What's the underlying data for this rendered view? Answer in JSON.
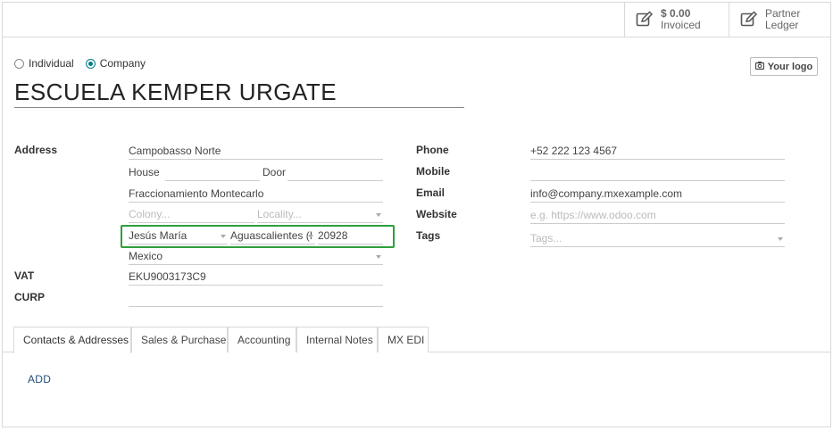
{
  "smart_buttons": {
    "invoiced": {
      "value": "$ 0.00",
      "label": "Invoiced",
      "icon": "pencil-square-icon"
    },
    "partner_ledger": {
      "line1": "Partner",
      "line2": "Ledger",
      "icon": "pencil-square-icon"
    }
  },
  "company_type": {
    "options": [
      {
        "label": "Individual",
        "selected": false
      },
      {
        "label": "Company",
        "selected": true
      }
    ]
  },
  "name": "ESCUELA KEMPER URGATE",
  "logo_button": "Your logo",
  "address": {
    "label": "Address",
    "street": "Campobasso Norte",
    "house_label": "House",
    "door_label": "Door",
    "street2": "Fraccionamiento Montecarlo",
    "colony_placeholder": "Colony...",
    "locality_placeholder": "Locality...",
    "city": "Jesús María",
    "state": "Aguascalientes (MX)",
    "state_display": "Aguascalientes (I",
    "zip": "20928",
    "country": "Mexico"
  },
  "vat": {
    "label": "VAT",
    "value": "EKU9003173C9"
  },
  "curp": {
    "label": "CURP",
    "value": ""
  },
  "phone": {
    "label": "Phone",
    "value": "+52 222 123 4567"
  },
  "mobile": {
    "label": "Mobile",
    "value": ""
  },
  "email": {
    "label": "Email",
    "value": "info@company.mxexample.com"
  },
  "website": {
    "label": "Website",
    "placeholder": "e.g. https://www.odoo.com"
  },
  "tags": {
    "label": "Tags",
    "placeholder": "Tags..."
  },
  "tabs": [
    {
      "label": "Contacts & Addresses",
      "active": true
    },
    {
      "label": "Sales & Purchase",
      "active": false
    },
    {
      "label": "Accounting",
      "active": false
    },
    {
      "label": "Internal Notes",
      "active": false
    },
    {
      "label": "MX EDI",
      "active": false
    }
  ],
  "add_label": "ADD",
  "colors": {
    "accent": "#017e84",
    "highlight": "#2ea03c",
    "link": "#1f4e79"
  }
}
